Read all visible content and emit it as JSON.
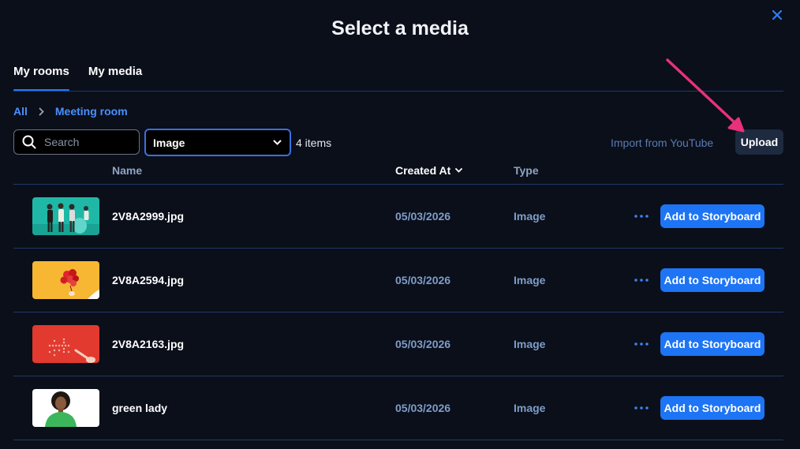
{
  "dialog": {
    "title": "Select a media",
    "close_icon": "close-icon"
  },
  "tabs": [
    {
      "label": "My rooms",
      "active": true
    },
    {
      "label": "My media",
      "active": false
    }
  ],
  "breadcrumb": {
    "items": [
      "All",
      "Meeting room"
    ]
  },
  "toolbar": {
    "search_placeholder": "Search",
    "filter_value": "Image",
    "item_count": "4 items",
    "import_label": "Import from YouTube",
    "upload_label": "Upload"
  },
  "table": {
    "columns": {
      "name": "Name",
      "created_at": "Created At",
      "type": "Type"
    },
    "rows": [
      {
        "name": "2V8A2999.jpg",
        "created_at": "05/03/2026",
        "type": "Image",
        "action": "Add to Storyboard",
        "thumb": "teal-group-photo"
      },
      {
        "name": "2V8A2594.jpg",
        "created_at": "05/03/2026",
        "type": "Image",
        "action": "Add to Storyboard",
        "thumb": "yellow-balloons-photo"
      },
      {
        "name": "2V8A2163.jpg",
        "created_at": "05/03/2026",
        "type": "Image",
        "action": "Add to Storyboard",
        "thumb": "red-lights-photo"
      },
      {
        "name": "green lady",
        "created_at": "05/03/2026",
        "type": "Image",
        "action": "Add to Storyboard",
        "thumb": "woman-portrait-photo"
      }
    ]
  },
  "colors": {
    "background": "#0a0f1a",
    "accent": "#1d74f5",
    "annotation_arrow": "#e8317a"
  }
}
